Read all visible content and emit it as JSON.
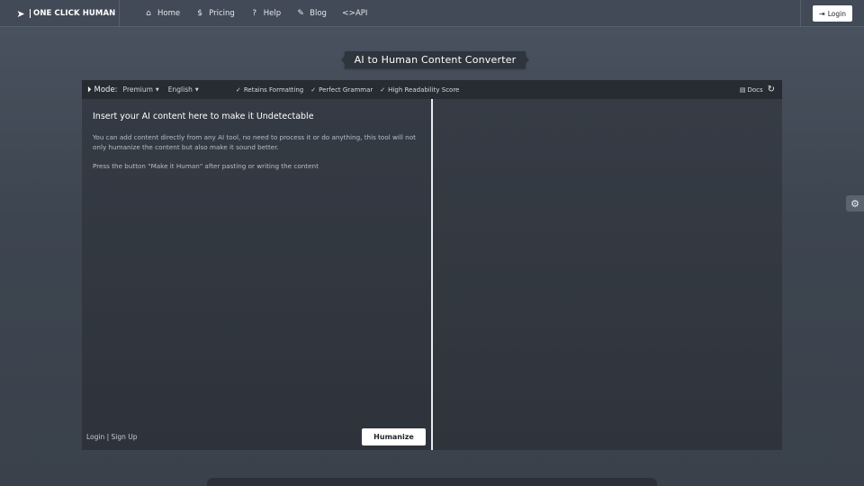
{
  "brand": {
    "name": "ONE CLICK HUMAN"
  },
  "nav": {
    "items": [
      {
        "label": "Home",
        "icon": "home-icon",
        "glyph": "⌂"
      },
      {
        "label": "Pricing",
        "icon": "dollar-icon",
        "glyph": "$"
      },
      {
        "label": "Help",
        "icon": "question-icon",
        "glyph": "?"
      },
      {
        "label": "Blog",
        "icon": "blog-icon",
        "glyph": "✎"
      },
      {
        "label": "API",
        "icon": "code-icon",
        "glyph": "<>"
      }
    ],
    "login_label": "Login"
  },
  "page": {
    "title": "AI to Human Content Converter"
  },
  "toolbar": {
    "mode_label": "Mode:",
    "mode_value": "Premium",
    "language_value": "English",
    "features": [
      "Retains Formatting",
      "Perfect Grammar",
      "High Readability Score"
    ],
    "docs_label": "Docs"
  },
  "input": {
    "heading": "Insert your AI content here to make it Undetectable",
    "paragraph1": "You can add content directly from any AI tool, no need to process it or do anything, this tool will not only humanize the content but also make it sound better.",
    "paragraph2": "Press the button \"Make it Human\" after pasting or writing the content"
  },
  "bottom": {
    "login_label": "Login",
    "separator": "|",
    "signup_label": "Sign Up",
    "humanize_label": "Humanize"
  },
  "colors": {
    "background": "#3d4550",
    "panel": "#2d333b",
    "toolbar": "#272c33",
    "button": "#ffffff"
  }
}
